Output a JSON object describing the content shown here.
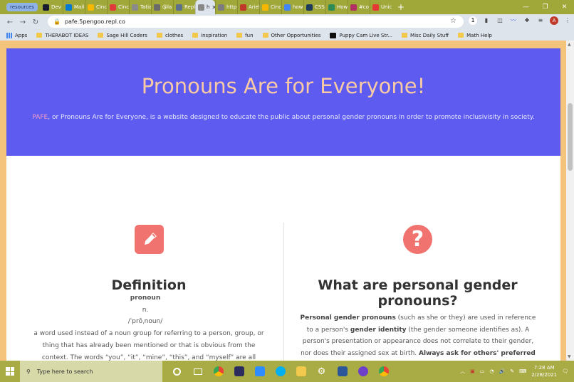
{
  "browser": {
    "tab_group_label": "resources",
    "tabs": [
      {
        "label": "Dev",
        "color": "#1a1a2e"
      },
      {
        "label": "Mail",
        "color": "#0078d4"
      },
      {
        "label": "Cinc",
        "color": "#f5b700"
      },
      {
        "label": "Cinc",
        "color": "#e03a3a"
      },
      {
        "label": "Tatia",
        "color": "#8a8a8a"
      },
      {
        "label": "@la",
        "color": "#6b6b6b"
      },
      {
        "label": "Repl",
        "color": "#5b6f8f"
      },
      {
        "label": "h",
        "color": "#888888",
        "active": true
      },
      {
        "label": "http:",
        "color": "#7d7d7d"
      },
      {
        "label": "Ariel",
        "color": "#c0392b"
      },
      {
        "label": "Cinc",
        "color": "#f5b700"
      },
      {
        "label": "how",
        "color": "#4285f4"
      },
      {
        "label": "CSS:",
        "color": "#1e3a5f"
      },
      {
        "label": "How",
        "color": "#2e8b57"
      },
      {
        "label": "#co",
        "color": "#b03060"
      },
      {
        "label": "Unic",
        "color": "#e53935"
      }
    ],
    "new_tab": "+",
    "url": "pafe.5pengoo.repl.co",
    "avatar_initial": "A",
    "window_controls": [
      "—",
      "❐",
      "✕"
    ],
    "bookmarks": [
      {
        "label": "Apps",
        "icon": "apps-grid"
      },
      {
        "label": "THERABOT IDEAS",
        "icon": "folder"
      },
      {
        "label": "Sage Hill Coders",
        "icon": "folder"
      },
      {
        "label": "clothes",
        "icon": "folder"
      },
      {
        "label": "inspiration",
        "icon": "folder"
      },
      {
        "label": "fun",
        "icon": "folder"
      },
      {
        "label": "Other Opportunities",
        "icon": "folder"
      },
      {
        "label": "Puppy Cam Live Str...",
        "icon": "puppy-cam"
      },
      {
        "label": "Misc Daily Stuff",
        "icon": "folder"
      },
      {
        "label": "Math Help",
        "icon": "folder"
      }
    ]
  },
  "page": {
    "hero_title": "Pronouns Are for Everyone!",
    "hero_acronym": "PAFE",
    "hero_text": ", or Pronouns Are for Everyone, is a website designed to educate the public about personal gender pronouns in order to promote inclusivisity in society.",
    "definition": {
      "title": "Definition",
      "word": "pronoun",
      "pos": "n.",
      "phonetic": "/ˈprōˌnoun/",
      "body": "a word used instead of a noun group for referring to a person, group, or thing that has already been mentioned or that is obvious from the context. The words “you”, “it”, “mine”, “this”, and “myself” are all pronouns. Words like"
    },
    "pronouns": {
      "title": "What are personal gender pronouns?",
      "term": "Personal gender pronouns",
      "text1": " (such as she or they) are used in reference to a person's ",
      "identity": "gender identity",
      "text2": " (the gender someone identifies as). A person's presentation or appearance does not correlate to their gender, nor does their assigned sex at birth. ",
      "emphasis": "Always ask for others' preferred pronouns no matter"
    },
    "colors": {
      "hero_bg": "#5d5bf0",
      "hero_title": "#f8caa5",
      "accent": "#f0736f",
      "page_bg": "#f4c47c"
    }
  },
  "taskbar": {
    "search_placeholder": "Type here to search",
    "time": "7:28 AM",
    "date": "2/28/2021"
  }
}
